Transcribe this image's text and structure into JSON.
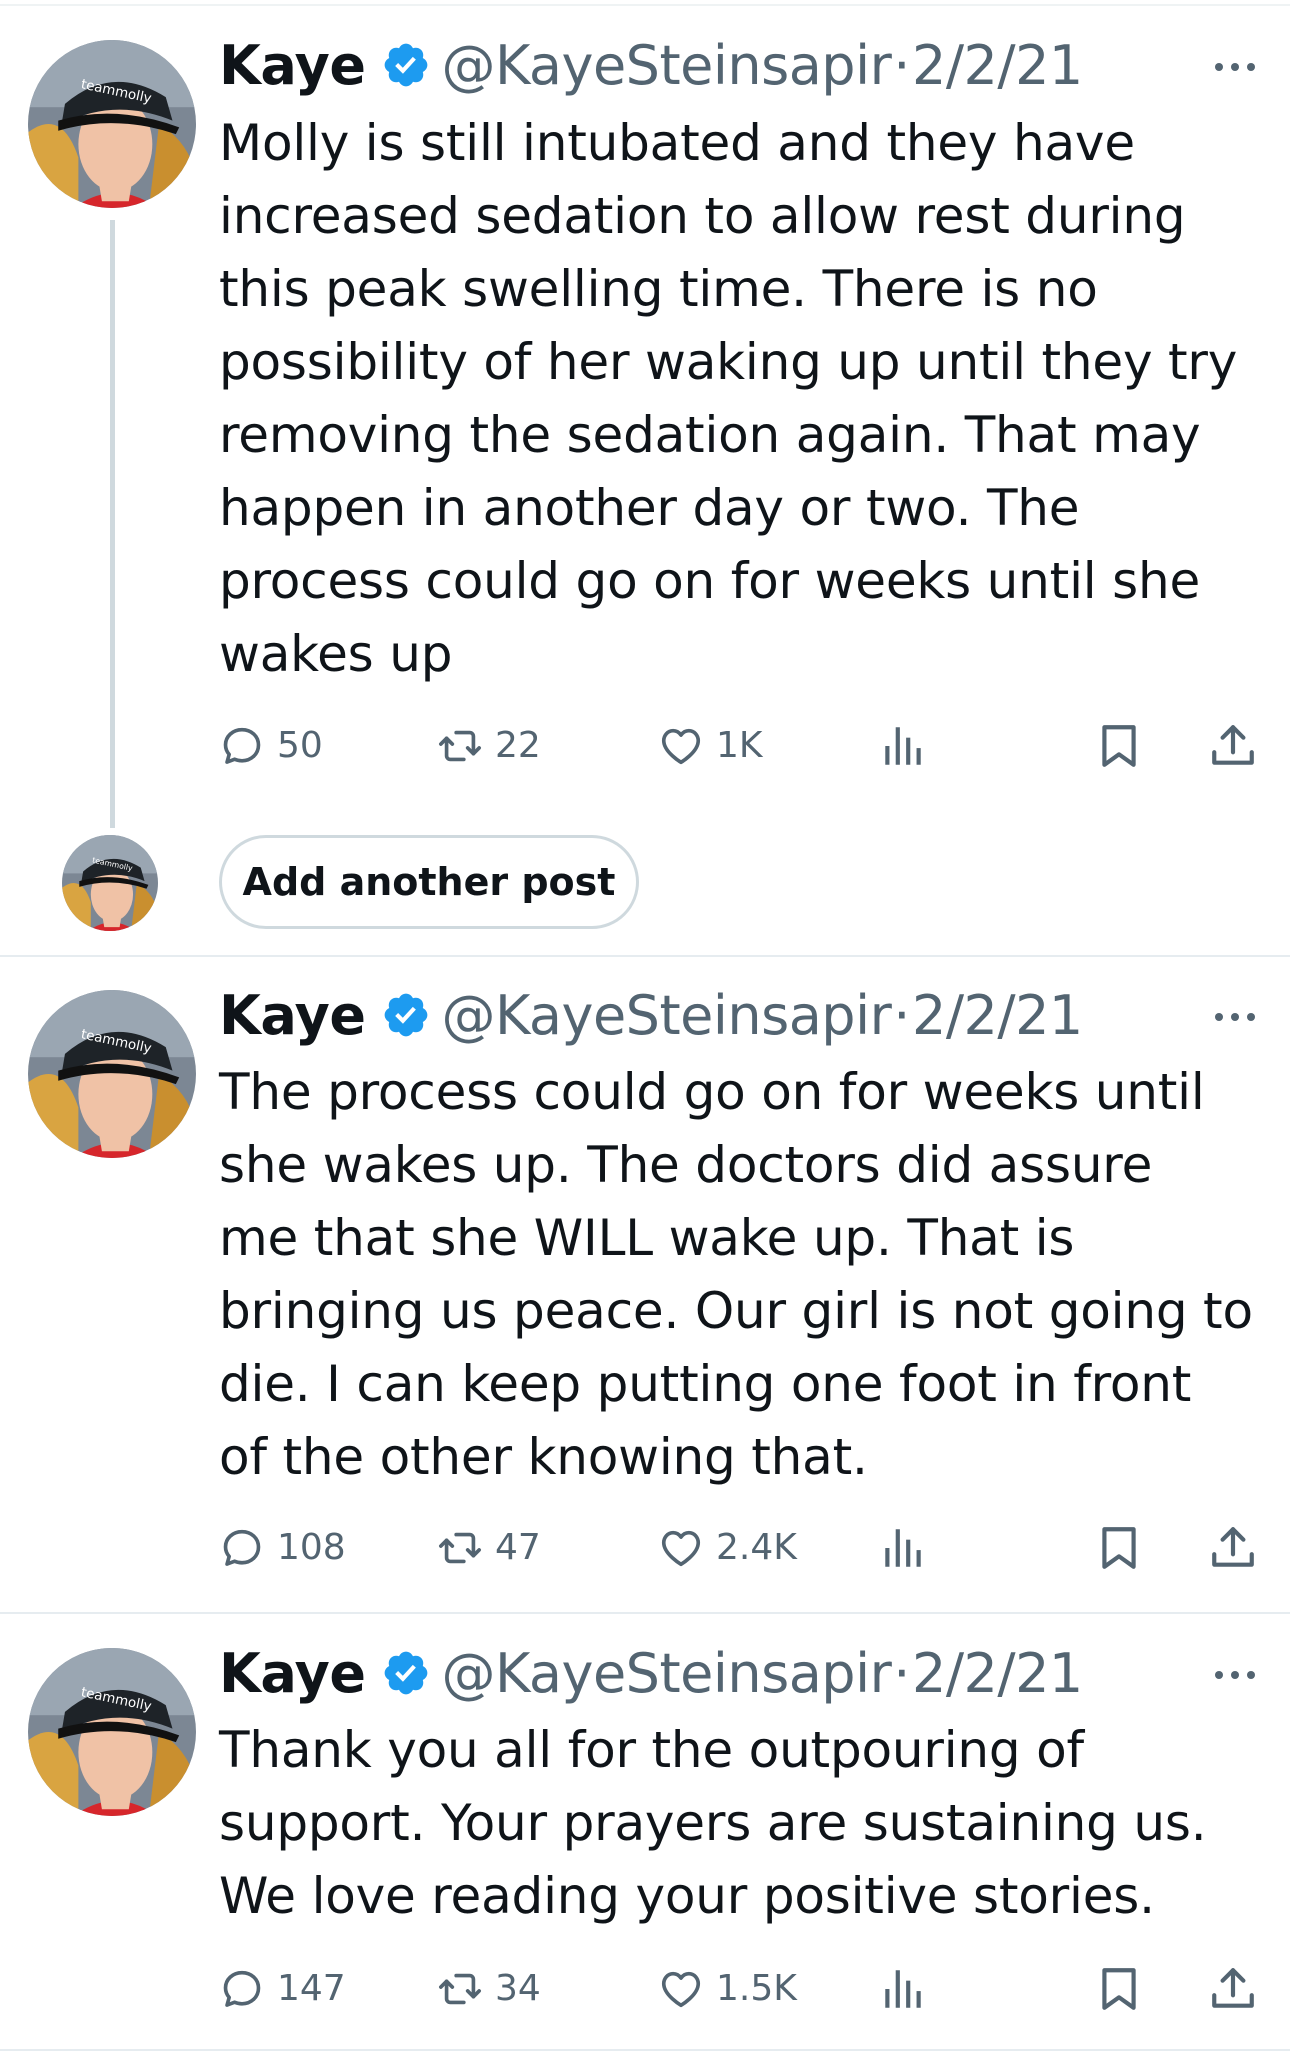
{
  "add_post_label": "Add another post",
  "colors": {
    "verified": "#1d9bf0",
    "secondary": "#536471"
  },
  "icons": [
    "reply-icon",
    "repost-icon",
    "like-icon",
    "views-icon",
    "bookmark-icon",
    "share-icon",
    "more-icon",
    "verified-badge-icon"
  ],
  "posts": [
    {
      "name": "Kaye",
      "handle": "@KayeSteinsapir",
      "sep": "·",
      "date": "2/2/21",
      "text": "Molly is still intubated and they have\nincreased sedation to allow rest during\nthis peak swelling time. There is no\npossibility of her waking up until they try\nremoving the sedation again. That may\nhappen in another day or two. The\nprocess could go on for weeks until she\nwakes up",
      "replies": "50",
      "reposts": "22",
      "likes": "1K"
    },
    {
      "name": "Kaye",
      "handle": "@KayeSteinsapir",
      "sep": "·",
      "date": "2/2/21",
      "text": "The process could go on for weeks until\nshe wakes up. The doctors did assure\nme that she WILL wake up. That is\nbringing us peace. Our girl is not going to\ndie. I can keep putting one foot in front\nof the other knowing that.",
      "replies": "108",
      "reposts": "47",
      "likes": "2.4K"
    },
    {
      "name": "Kaye",
      "handle": "@KayeSteinsapir",
      "sep": "·",
      "date": "2/2/21",
      "text": "Thank you all for the outpouring of\nsupport. Your prayers are sustaining us.\nWe love reading your positive stories.",
      "replies": "147",
      "reposts": "34",
      "likes": "1.5K"
    }
  ]
}
